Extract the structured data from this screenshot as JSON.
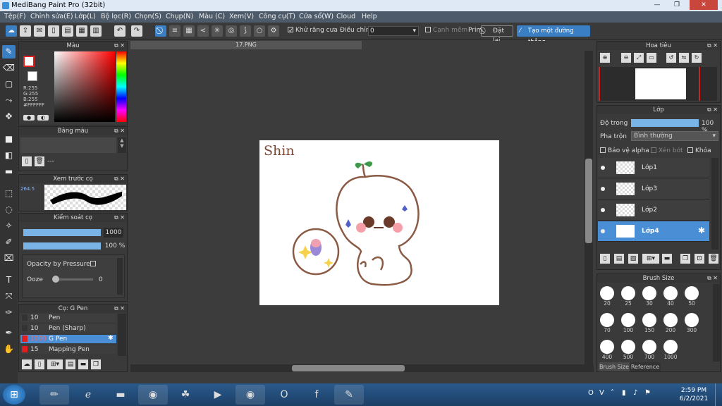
{
  "window": {
    "title": "MediBang Paint Pro (32bit)"
  },
  "menu": [
    "Tệp(F)",
    "Chỉnh sửa(E)",
    "Lớp(L)",
    "Bộ lọc(R)",
    "Chọn(S)",
    "Chụp(N)",
    "Màu (C)",
    "Xem(V)",
    "Công cụ(T)",
    "Cửa sổ(W)",
    "Cloud",
    "Help"
  ],
  "toolbar": {
    "antialias_label": "Khử răng cưa",
    "adjust_label": "Điều chỉnh",
    "adjust_value": "0",
    "snap_label": "Cạnh mềm",
    "prime_label": "Prim",
    "prime_btn": "Đặt lại",
    "new_line_btn": "Tạo một đường thẳng"
  },
  "color_panel": {
    "title": "Màu",
    "r": "R:255",
    "g": "G:255",
    "b": "B:255",
    "hex": "#FFFFFF"
  },
  "palette_panel": {
    "title": "Bảng màu",
    "dash": "---"
  },
  "preview_panel": {
    "title": "Xem trước cọ",
    "size": "264.5"
  },
  "brush_ctrl": {
    "title": "Kiểm soát cọ",
    "size": "1000",
    "opacity": "100 %",
    "pressure": "Opacity by Pressure",
    "ooze": "Ooze",
    "ooze_val": "0"
  },
  "brushes_panel": {
    "title": "Cọ: G Pen",
    "items": [
      {
        "size": "10",
        "name": "Pen"
      },
      {
        "size": "10",
        "name": "Pen (Sharp)"
      },
      {
        "size": "1000",
        "name": "G Pen"
      },
      {
        "size": "15",
        "name": "Mapping Pen"
      }
    ]
  },
  "document": {
    "tab": "17.PNG",
    "canvas_text": "Shin"
  },
  "nav_panel": {
    "title": "Hoa tiêu"
  },
  "layer_panel": {
    "title": "Lớp",
    "opacity_label": "Độ trong",
    "opacity_value": "100 %",
    "blend_label": "Pha trộn",
    "blend_value": "Bình thường",
    "protect": "Bảo vệ alpha",
    "clip": "Xén bớt",
    "lock": "Khóa",
    "layers": [
      "Lớp1",
      "Lớp3",
      "Lớp2",
      "Lớp4"
    ]
  },
  "brush_size_panel": {
    "title": "Brush Size",
    "sizes": [
      "20",
      "25",
      "30",
      "40",
      "50",
      "70",
      "100",
      "150",
      "200",
      "300",
      "400",
      "500",
      "700",
      "1000"
    ],
    "tabs": [
      "Brush Size",
      "Reference"
    ]
  },
  "taskbar": {
    "time": "2:59 PM",
    "date": "6/2/2021"
  },
  "colors": {
    "accent": "#3a7fc4",
    "canvas_bg": "#ffffff",
    "workspace": "#3c3c3c"
  }
}
